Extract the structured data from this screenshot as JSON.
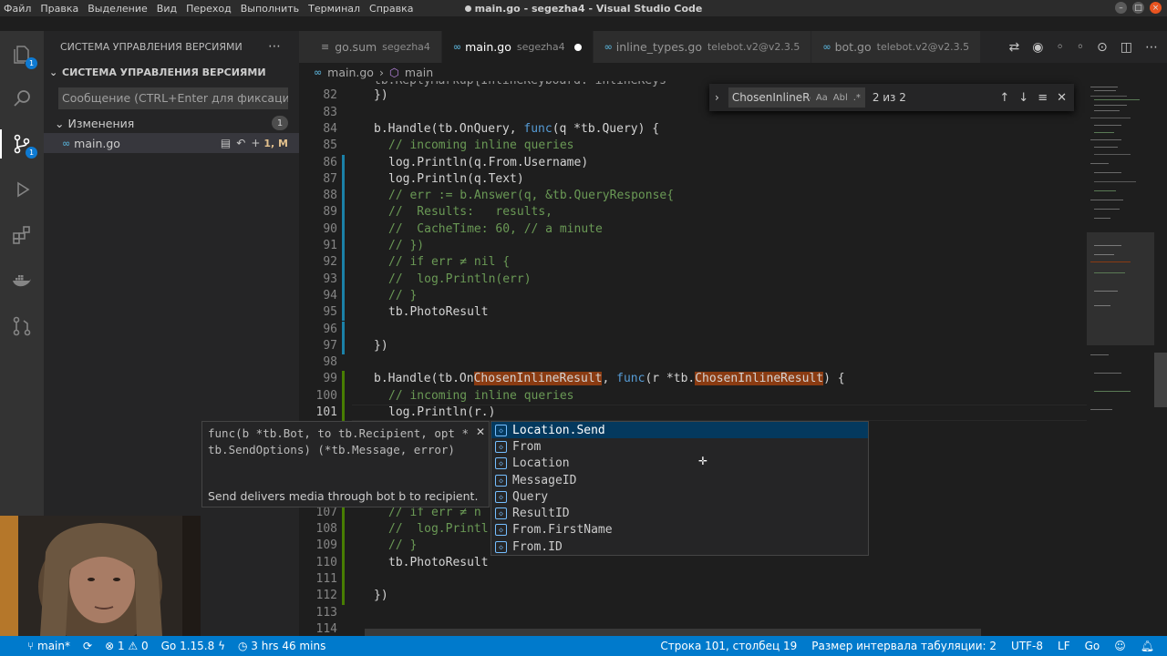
{
  "titlebar": {
    "menu": [
      "Файл",
      "Правка",
      "Выделение",
      "Вид",
      "Переход",
      "Выполнить",
      "Терминал",
      "Справка"
    ],
    "title": "main.go - segezha4 - Visual Studio Code"
  },
  "activity": {
    "scm_badge": "1",
    "explorer_badge": "1"
  },
  "sidebar": {
    "header": "СИСТЕМА УПРАВЛЕНИЯ ВЕРСИЯМИ",
    "section": "СИСТЕМА УПРАВЛЕНИЯ ВЕРСИЯМИ",
    "commit_placeholder": "Сообщение (CTRL+Enter для фиксации ...",
    "changes_label": "Изменения",
    "changes_count": "1",
    "file_name": "main.go",
    "file_status": "1, M"
  },
  "tabs": [
    {
      "name": "go.sum",
      "desc": "segezha4"
    },
    {
      "name": "main.go",
      "desc": "segezha4"
    },
    {
      "name": "inline_types.go",
      "desc": "telebot.v2@v2.3.5"
    },
    {
      "name": "bot.go",
      "desc": "telebot.v2@v2.3.5"
    }
  ],
  "breadcrumb": {
    "file": "main.go",
    "symbol": "main"
  },
  "find": {
    "term": "ChosenInlineRe",
    "match_case": "Aa",
    "whole_word": "Abl",
    "result": "2 из 2"
  },
  "editor": {
    "line_numbers": [
      "82",
      "83",
      "84",
      "85",
      "86",
      "87",
      "88",
      "89",
      "90",
      "91",
      "92",
      "93",
      "94",
      "95",
      "96",
      "97",
      "98",
      "99",
      "100",
      "101",
      "107",
      "108",
      "109",
      "110",
      "111",
      "112",
      "113",
      "114"
    ],
    "line_81_partial": "tb.ReplyMarkup{InlineKeyboard: inlineKeys",
    "l82": "})",
    "l84a": "b.Handle(tb.OnQuery, ",
    "l84b": "func",
    "l84c": "(q *tb.Query) {",
    "l85": "// incoming inline queries",
    "l86": "log.Println(q.From.Username)",
    "l87": "log.Println(q.Text)",
    "l88": "// err := b.Answer(q, &tb.QueryResponse{",
    "l89": "//  Results:   results,",
    "l90": "//  CacheTime: 60, // a minute",
    "l91": "// })",
    "l92": "// if err ≠ nil {",
    "l93": "//  log.Println(err)",
    "l94": "// }",
    "l95": "tb.PhotoResult",
    "l97": "})",
    "l99a": "b.Handle(tb.On",
    "l99b": "ChosenInlineResult",
    "l99c": ", ",
    "l99d": "func",
    "l99e": "(r *tb.",
    "l99f": "ChosenInlineResult",
    "l99g": ") {",
    "l100": "// incoming inline queries",
    "l101": "log.Println(r.)",
    "l107": "// if err ≠ n",
    "l108": "//  log.Printl",
    "l109": "// }",
    "l110": "tb.PhotoResult",
    "l112": "})"
  },
  "suggest": {
    "items": [
      "Location.Send",
      "From",
      "Location",
      "MessageID",
      "Query",
      "ResultID",
      "From.FirstName",
      "From.ID"
    ]
  },
  "detail": {
    "signature": "func(b *tb.Bot, to tb.Recipient, opt *tb.SendOptions) (*tb.Message, error)",
    "doc": "Send delivers media through bot b to recipient."
  },
  "statusbar": {
    "branch": "main*",
    "errors": "1",
    "warnings": "0",
    "go_version": "Go 1.15.8",
    "time": "3 hrs 46 mins",
    "position": "Строка 101, столбец 19",
    "indent": "Размер интервала табуляции: 2",
    "encoding": "UTF-8",
    "eol": "LF",
    "language": "Go"
  }
}
